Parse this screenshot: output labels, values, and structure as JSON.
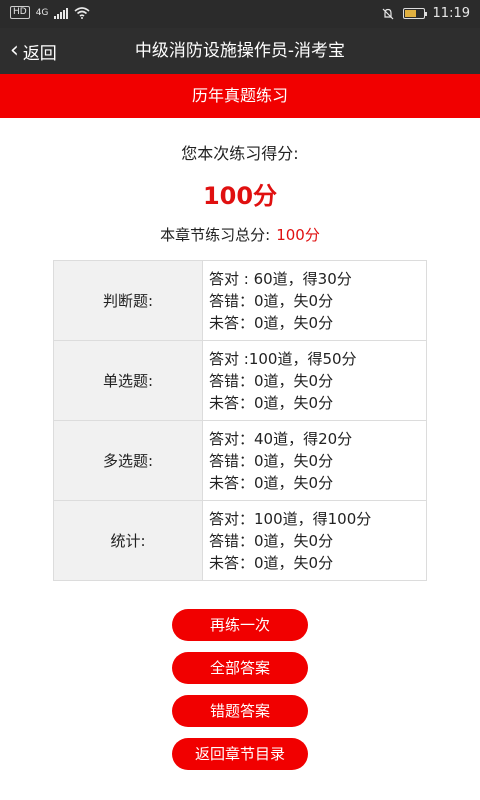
{
  "status_bar": {
    "hd_label": "HD",
    "network_label": "4G",
    "battery_level": 0.6,
    "time": "11:19"
  },
  "nav": {
    "back_label": "返回",
    "title": "中级消防设施操作员-消考宝"
  },
  "section": {
    "title": "历年真题练习"
  },
  "score": {
    "label": "您本次练习得分:",
    "value": "100分",
    "total_label": "本章节练习总分:",
    "total_value": "100分"
  },
  "results": [
    {
      "category": "判断题:",
      "lines": [
        "答对 : 60道，得30分",
        "答错：0道，失0分",
        "未答：0道，失0分"
      ]
    },
    {
      "category": "单选题:",
      "lines": [
        "答对 :100道，得50分",
        "答错：0道，失0分",
        "未答：0道，失0分"
      ]
    },
    {
      "category": "多选题:",
      "lines": [
        "答对：40道，得20分",
        "答错：0道，失0分",
        "未答：0道，失0分"
      ]
    },
    {
      "category": "统计:",
      "lines": [
        "答对：100道，得100分",
        "答错：0道，失0分",
        "未答：0道，失0分"
      ]
    }
  ],
  "buttons": {
    "retry": "再练一次",
    "all_answers": "全部答案",
    "wrong_answers": "错题答案",
    "back_to_chapters": "返回章节目录"
  },
  "colors": {
    "accent": "#f10000",
    "score_red": "#e01010",
    "nav_bg": "#2e2e2e"
  }
}
